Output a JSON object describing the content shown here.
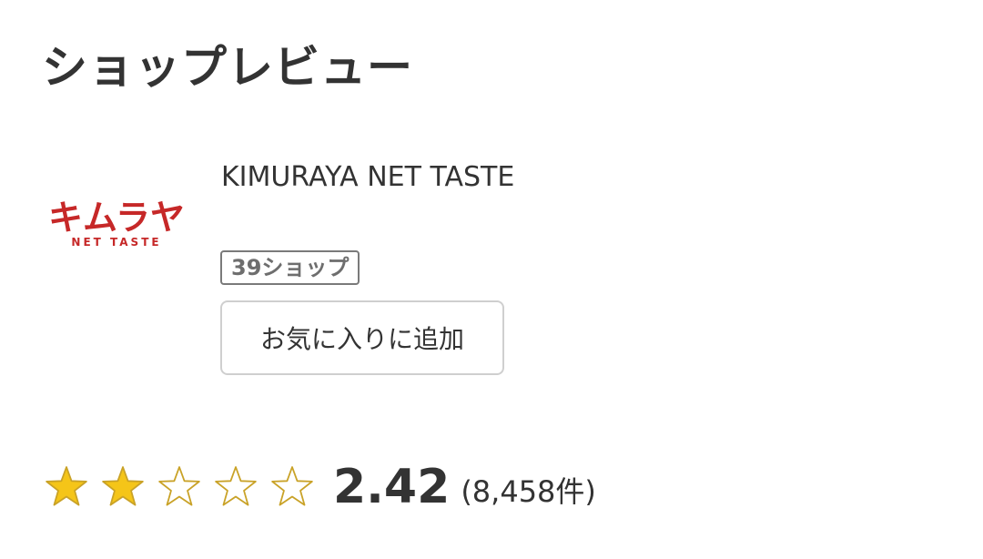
{
  "page": {
    "title": "ショップレビュー"
  },
  "shop": {
    "name": "KIMURAYA NET TASTE",
    "logo_text": "キムラヤ",
    "logo_subtext": "NET TASTE",
    "logo_color": "#c62828",
    "badge": "39ショップ",
    "favorite_label": "お気に入りに追加"
  },
  "rating": {
    "score": "2.42",
    "score_value": 2.42,
    "max_stars": 5,
    "filled_stars": 2,
    "count_text": "(8,458件)",
    "star_fill_color": "#f5c518",
    "star_outline_color": "#c9a227"
  }
}
